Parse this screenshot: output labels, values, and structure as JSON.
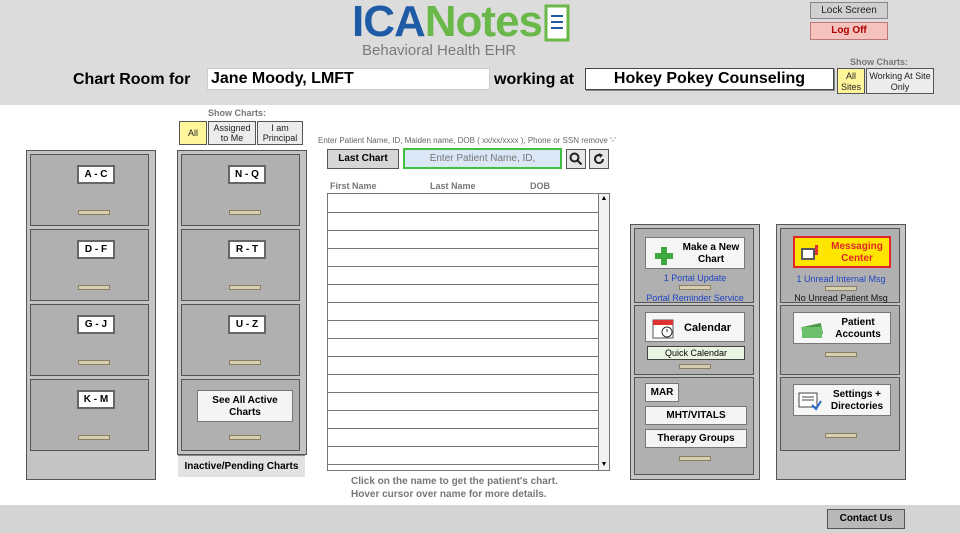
{
  "logo": {
    "brand_part1": "ICA",
    "brand_part2": "Notes",
    "subtitle": "Behavioral Health EHR"
  },
  "header": {
    "lock_screen": "Lock Screen",
    "log_off": "Log Off",
    "chart_room_label": "Chart Room for",
    "user_name": "Jane Moody, LMFT",
    "working_at_label": "working at",
    "site_name": "Hokey Pokey Counseling",
    "show_charts_label": "Show Charts:",
    "all_sites": "All Sites",
    "working_at_site_only": "Working At Site Only"
  },
  "chart_filters": {
    "label": "Show Charts:",
    "all": "All",
    "assigned": "Assigned to Me",
    "principal": "I am Principal"
  },
  "cabinet_left": {
    "drawers": [
      "A - C",
      "D - F",
      "G - J",
      "K - M"
    ]
  },
  "cabinet_middle": {
    "drawers": [
      "N - Q",
      "R - T",
      "U - Z"
    ],
    "see_all": "See All Active Charts",
    "inactive": "Inactive/Pending Charts"
  },
  "search": {
    "hint": "Enter Patient Name, ID, Maiden name, DOB ( xx/xx/xxxx ), Phone or SSN remove '-'",
    "last_chart": "Last Chart",
    "placeholder": "Enter Patient Name, ID,",
    "search_icon": "magnifier-icon",
    "refresh_icon": "refresh-icon"
  },
  "patient_list": {
    "columns": [
      "First Name",
      "Last Name",
      "DOB"
    ],
    "rows": 15,
    "hint_line1": "Click on the name to get the patient's chart.",
    "hint_line2": "Hover cursor over name for more details."
  },
  "panel_center": {
    "make_chart": "Make a New Chart",
    "portal_update": "1 Portal Update",
    "portal_reminder": "Portal Reminder Service",
    "calendar": "Calendar",
    "quick_calendar": "Quick Calendar",
    "mar": "MAR",
    "mht_vitals": "MHT/VITALS",
    "therapy_groups": "Therapy Groups"
  },
  "panel_right": {
    "messaging": "Messaging Center",
    "unread_internal": "1 Unread Internal Msg",
    "unread_patient": "No Unread Patient Msg",
    "patient_accounts": "Patient Accounts",
    "settings": "Settings + Directories"
  },
  "footer": {
    "contact_us": "Contact Us"
  },
  "colors": {
    "brand_blue": "#1f5aa6",
    "brand_green": "#6bb84a",
    "selected_yellow": "#fff59a",
    "messaging_red": "#e0262a"
  }
}
